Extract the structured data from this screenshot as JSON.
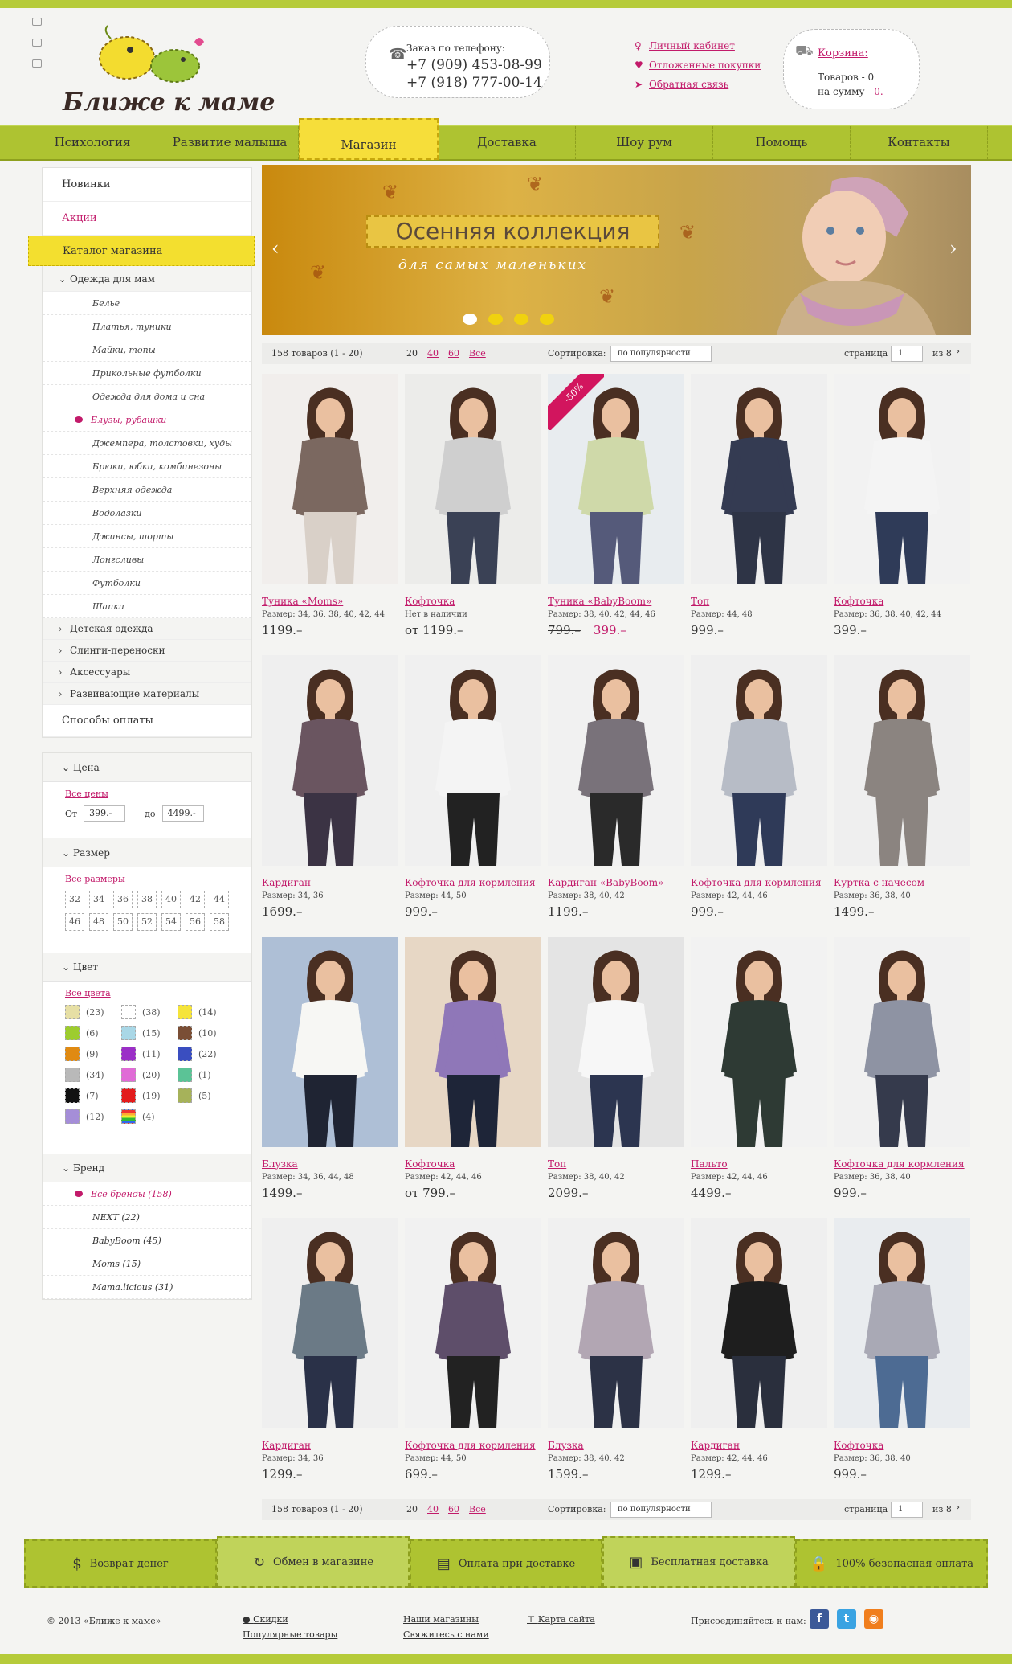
{
  "header": {
    "logo_text": "Ближе к маме",
    "phone_label": "Заказ по телефону:",
    "phones": [
      "+7 (909) 453-08-99",
      "+7 (918) 777-00-14"
    ],
    "user_links": [
      "Личный кабинет",
      "Отложенные покупки",
      "Обратная связь"
    ],
    "cart": {
      "title": "Корзина:",
      "items_line": "Товаров - 0",
      "sum_label": "на сумму -",
      "sum_value": "0.–"
    }
  },
  "nav": [
    "Психология",
    "Развитие малыша",
    "Магазин",
    "Доставка",
    "Шоу рум",
    "Помощь",
    "Контакты"
  ],
  "sidebar": {
    "top": [
      "Новинки",
      "Акции",
      "Каталог магазина"
    ],
    "moms_group": "Одежда для мам",
    "moms_items": [
      "Белье",
      "Платья, туники",
      "Майки, топы",
      "Прикольные футболки",
      "Одежда для дома и сна",
      "Блузы, рубашки",
      "Джемпера, толстовки, худы",
      "Брюки, юбки, комбинезоны",
      "Верхняя одежда",
      "Водолазки",
      "Джинсы, шорты",
      "Лонгсливы",
      "Футболки",
      "Шапки"
    ],
    "groups": [
      "Детская одежда",
      "Слинги-переноски",
      "Аксессуары",
      "Развивающие материалы"
    ],
    "payment": "Способы оплаты",
    "price": {
      "title": "Цена",
      "all": "Все цены",
      "from": "От",
      "from_value": "399.-",
      "to": "до",
      "to_value": "4499.-"
    },
    "size": {
      "title": "Размер",
      "all": "Все размеры",
      "values": [
        "32",
        "34",
        "36",
        "38",
        "40",
        "42",
        "44",
        "46",
        "48",
        "50",
        "52",
        "54",
        "56",
        "58"
      ]
    },
    "color": {
      "title": "Цвет",
      "all": "Все цвета",
      "items": [
        {
          "color": "#e6dfa5",
          "count": "(23)"
        },
        {
          "color": "#ffffff",
          "count": "(38)"
        },
        {
          "color": "#f5e43a",
          "count": "(14)"
        },
        {
          "color": "#9dcc2e",
          "count": "(6)"
        },
        {
          "color": "#a9d7e6",
          "count": "(15)"
        },
        {
          "color": "#7a4e35",
          "count": "(10)"
        },
        {
          "color": "#e08a12",
          "count": "(9)"
        },
        {
          "color": "#9b2fc7",
          "count": "(11)"
        },
        {
          "color": "#3a4ec0",
          "count": "(22)"
        },
        {
          "color": "#b9b9b9",
          "count": "(34)"
        },
        {
          "color": "#e06bd6",
          "count": "(20)"
        },
        {
          "color": "#5bc396",
          "count": "(1)"
        },
        {
          "color": "#111111",
          "count": "(7)"
        },
        {
          "color": "#e31b1b",
          "count": "(19)"
        },
        {
          "color": "#a6b25a",
          "count": "(5)"
        },
        {
          "color": "#a58ed8",
          "count": "(12)"
        },
        {
          "color": "#e7a33a",
          "count": "(4)"
        }
      ]
    },
    "brand": {
      "title": "Бренд",
      "items": [
        "Все бренды (158)",
        "NEXT (22)",
        "BabyBoom (45)",
        "Moms (15)",
        "Mama.licious (31)"
      ]
    }
  },
  "banner": {
    "title": "Осенняя коллекция",
    "subtitle": "для самых маленьких"
  },
  "toolbar": {
    "count": "158 товаров (1 - 20)",
    "per_page": [
      "20",
      "40",
      "60",
      "Все"
    ],
    "sort_label": "Сортировка:",
    "sort_value": "по популярности",
    "page_label": "страница",
    "page_value": "1",
    "of": "из 8"
  },
  "products": [
    {
      "name": "Туника «Moms»",
      "size": "Размер: 34, 36, 38, 40, 42, 44",
      "price": "1199.–",
      "top": "#7b6860",
      "bottom": "#d9d0c8",
      "bg": "#f1eeec"
    },
    {
      "name": "Кофточка",
      "size": "Нет в наличии",
      "price": "от 1199.–",
      "top": "#cfcfcf",
      "bottom": "#3a4155",
      "bg": "#ececea"
    },
    {
      "name": "Туника «BabyBoom»",
      "size": "Размер: 38, 40, 42, 44, 46",
      "old_price": "799.–",
      "price": "399.–",
      "sale": "-50%",
      "top": "#cfd9a9",
      "bottom": "#555a7a",
      "bg": "#e8ecef"
    },
    {
      "name": "Топ",
      "size": "Размер: 44, 48",
      "price": "999.–",
      "top": "#343b52",
      "bottom": "#2e3446",
      "bg": "#efefef"
    },
    {
      "name": "Кофточка",
      "size": "Размер: 36, 38, 40, 42, 44",
      "price": "399.–",
      "top": "#f4f4f4",
      "bottom": "#2f3b58",
      "bg": "#f2f2f2"
    },
    {
      "name": "Кардиган",
      "size": "Размер: 34, 36",
      "price": "1699.–",
      "top": "#6a5560",
      "bottom": "#3b3344",
      "bg": "#efefef"
    },
    {
      "name": "Кофточка для кормления",
      "size": "Размер: 44, 50",
      "price": "999.–",
      "top": "#f4f4f4",
      "bottom": "#222222",
      "bg": "#f0f0f0"
    },
    {
      "name": "Кардиган «BabyBoom»",
      "size": "Размер: 38, 40, 42",
      "price": "1199.–",
      "top": "#79727a",
      "bottom": "#2a2a2a",
      "bg": "#f1f1f1"
    },
    {
      "name": "Кофточка для кормления",
      "size": "Размер: 42, 44, 46",
      "price": "999.–",
      "top": "#b7bcc6",
      "bottom": "#2f3a58",
      "bg": "#efefef"
    },
    {
      "name": "Куртка с начесом",
      "size": "Размер: 36, 38, 40",
      "price": "1499.–",
      "top": "#8b8480",
      "bottom": "#8b8480",
      "bg": "#efefef"
    },
    {
      "name": "Блузка",
      "size": "Размер: 34, 36, 44, 48",
      "price": "1499.–",
      "top": "#f7f7f4",
      "bottom": "#1f2433",
      "bg": "#aebfd6"
    },
    {
      "name": "Кофточка",
      "size": "Размер: 42, 44, 46",
      "price": "от 799.–",
      "top": "#8f77b8",
      "bottom": "#1e2538",
      "bg": "#e7d7c5"
    },
    {
      "name": "Топ",
      "size": "Размер: 38, 40, 42",
      "price": "2099.–",
      "top": "#f7f7f7",
      "bottom": "#2c3550",
      "bg": "#e4e4e4"
    },
    {
      "name": "Пальто",
      "size": "Размер: 42, 44, 46",
      "price": "4499.–",
      "top": "#2e3a34",
      "bottom": "#2e3a34",
      "bg": "#f2f2f2"
    },
    {
      "name": "Кофточка для кормления",
      "size": "Размер: 36, 38, 40",
      "price": "999.–",
      "top": "#8e93a3",
      "bottom": "#353a4c",
      "bg": "#f1f1f1"
    },
    {
      "name": "Кардиган",
      "size": "Размер: 34, 36",
      "price": "1299.–",
      "top": "#6b7a86",
      "bottom": "#2a3148",
      "bg": "#efefef"
    },
    {
      "name": "Кофточка для кормления",
      "size": "Размер: 44, 50",
      "price": "699.–",
      "top": "#5e4e6a",
      "bottom": "#222222",
      "bg": "#f1f1f1"
    },
    {
      "name": "Блузка",
      "size": "Размер: 38, 40, 42",
      "price": "1599.–",
      "top": "#b2a6b3",
      "bottom": "#2c3246",
      "bg": "#f0f0f0"
    },
    {
      "name": "Кардиган",
      "size": "Размер: 42, 44, 46",
      "price": "1299.–",
      "top": "#1e1e1e",
      "bottom": "#2a2f3d",
      "bg": "#efefef"
    },
    {
      "name": "Кофточка",
      "size": "Размер: 36, 38, 40",
      "price": "999.–",
      "top": "#a9a9b5",
      "bottom": "#4d6b93",
      "bg": "#e9ecef"
    }
  ],
  "features": [
    "Возврат денег",
    "Обмен в магазине",
    "Оплата при доставке",
    "Бесплатная доставка",
    "100% безопасная оплата"
  ],
  "footer": {
    "copyright": "© 2013 «Ближе к маме»",
    "col1": [
      "Скидки",
      "Популярные товары"
    ],
    "col2": [
      "Наши магазины",
      "Свяжитесь с нами"
    ],
    "sitemap": "Карта сайта",
    "join": "Присоединяйтесь к нам:"
  }
}
